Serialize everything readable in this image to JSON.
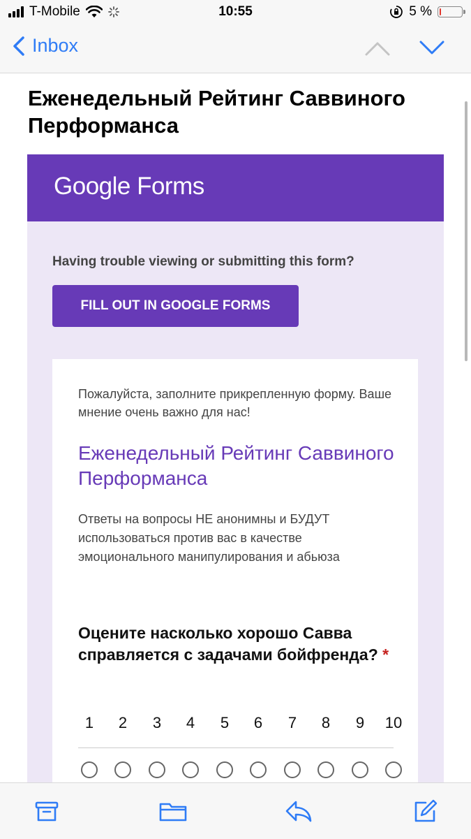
{
  "status": {
    "carrier": "T-Mobile",
    "time": "10:55",
    "battery_text": "5 %",
    "battery_level": 0.05,
    "battery_color": "#e0352b"
  },
  "nav": {
    "back_label": "Inbox",
    "icons": [
      "chevron-left-icon",
      "chevron-up-icon",
      "chevron-down-icon"
    ]
  },
  "email": {
    "subject": "Еженедельный Рейтинг Саввиного Перформанса"
  },
  "forms": {
    "logo_text": "Google Forms",
    "trouble_text": "Having trouble viewing or submitting this form?",
    "fill_button": "FILL OUT IN GOOGLE FORMS",
    "accent_color": "#673ab7",
    "panel_color": "#ede7f6"
  },
  "card": {
    "description": "Пожалуйста, заполните прикрепленную форму. Ваше мнение очень важно для нас!",
    "title": "Еженедельный Рейтинг Саввиного Перформанса",
    "note": "Ответы на вопросы НЕ анонимны и БУДУТ использоваться против вас в качестве эмоционального манипулирования и абьюза",
    "question": "Оцените насколько хорошо Савва справляется с задачами бойфренда?",
    "required_mark": "*",
    "scale": [
      "1",
      "2",
      "3",
      "4",
      "5",
      "6",
      "7",
      "8",
      "9",
      "10"
    ]
  },
  "toolbar": {
    "icons": [
      "archive-icon",
      "folder-icon",
      "reply-icon",
      "compose-icon"
    ]
  }
}
